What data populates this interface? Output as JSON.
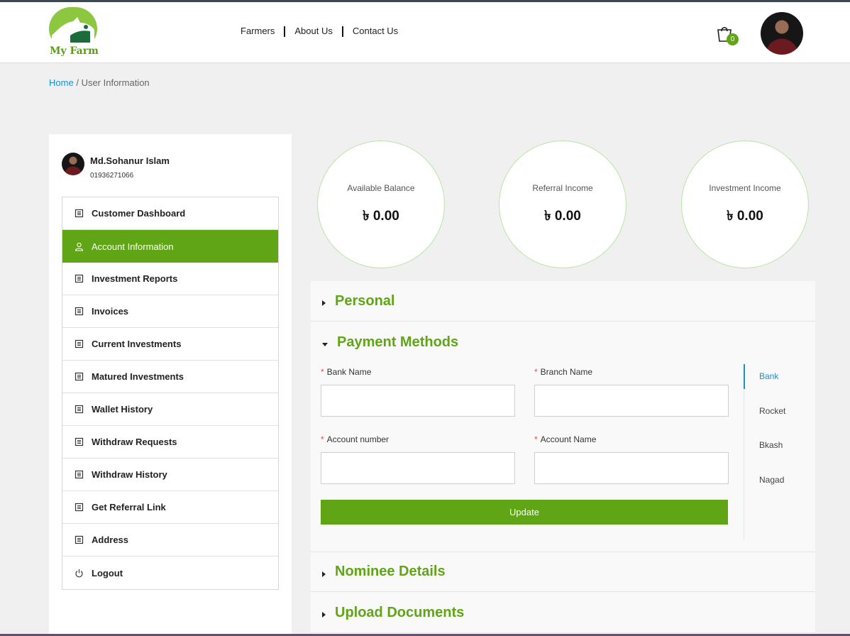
{
  "brand": {
    "logo_text": "My Farm"
  },
  "nav": {
    "items": [
      "Farmers",
      "About Us",
      "Contact Us"
    ]
  },
  "cart": {
    "count": "0"
  },
  "breadcrumb": {
    "home": "Home",
    "separator": "/",
    "current": "User Information"
  },
  "profile": {
    "name": "Md.Sohanur Islam",
    "phone": "01936271066"
  },
  "sidebar": {
    "items": [
      {
        "label": "Customer Dashboard",
        "icon": "document-icon"
      },
      {
        "label": "Account Information",
        "icon": "user-icon",
        "active": true
      },
      {
        "label": "Investment Reports",
        "icon": "document-icon"
      },
      {
        "label": "Invoices",
        "icon": "document-icon"
      },
      {
        "label": "Current Investments",
        "icon": "document-icon"
      },
      {
        "label": "Matured Investments",
        "icon": "document-icon"
      },
      {
        "label": "Wallet History",
        "icon": "document-icon"
      },
      {
        "label": "Withdraw Requests",
        "icon": "document-icon"
      },
      {
        "label": "Withdraw History",
        "icon": "document-icon"
      },
      {
        "label": "Get Referral Link",
        "icon": "document-icon"
      },
      {
        "label": "Address",
        "icon": "document-icon"
      },
      {
        "label": "Logout",
        "icon": "power-icon"
      }
    ]
  },
  "stats": [
    {
      "label": "Available Balance",
      "value": "৳ 0.00"
    },
    {
      "label": "Referral Income",
      "value": "৳ 0.00"
    },
    {
      "label": "Investment Income",
      "value": "৳ 0.00"
    }
  ],
  "sections": {
    "personal": "Personal",
    "payment": "Payment Methods",
    "nominee": "Nominee Details",
    "upload": "Upload Documents"
  },
  "payment_form": {
    "bank_name_label": "Bank Name",
    "branch_name_label": "Branch Name",
    "account_number_label": "Account number",
    "account_name_label": "Account Name",
    "bank_name_value": "",
    "branch_name_value": "",
    "account_number_value": "",
    "account_name_value": "",
    "update_label": "Update"
  },
  "payment_tabs": [
    "Bank",
    "Rocket",
    "Bkash",
    "Nagad"
  ],
  "colors": {
    "brand_green": "#5fa516",
    "link_blue": "#1a8fd1",
    "required_red": "#e74c3c"
  }
}
